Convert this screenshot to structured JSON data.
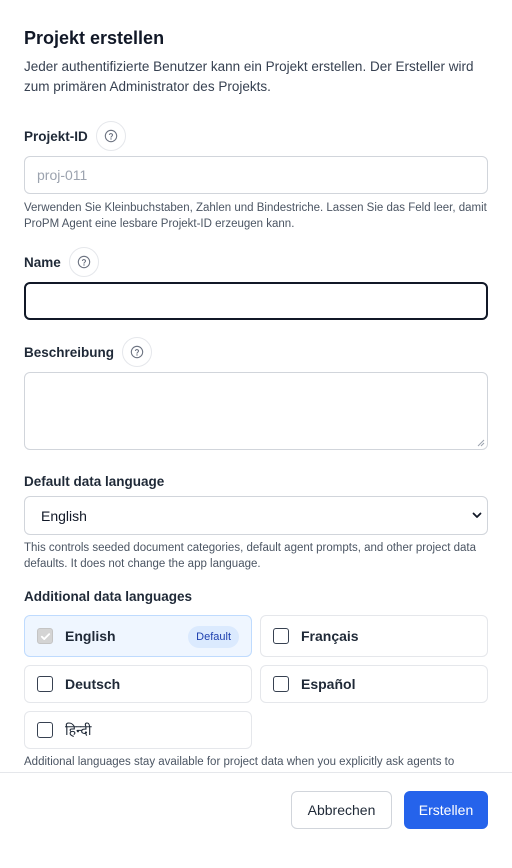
{
  "dialog": {
    "title": "Projekt erstellen",
    "subtitle": "Jeder authentifizierte Benutzer kann ein Projekt erstellen. Der Ersteller wird zum primären Administrator des Projekts."
  },
  "project_id": {
    "label": "Projekt-ID",
    "placeholder": "proj-011",
    "value": "",
    "hint": "Verwenden Sie Kleinbuchstaben, Zahlen und Bindestriche. Lassen Sie das Feld leer, damit ProPM Agent eine lesbare Projekt-ID erzeugen kann."
  },
  "name": {
    "label": "Name",
    "value": ""
  },
  "description": {
    "label": "Beschreibung",
    "value": ""
  },
  "default_language": {
    "label": "Default data language",
    "selected": "English",
    "hint": "This controls seeded document categories, default agent prompts, and other project data defaults. It does not change the app language."
  },
  "additional_languages": {
    "label": "Additional data languages",
    "items": [
      {
        "label": "English",
        "checked": true,
        "badge": "Default"
      },
      {
        "label": "Français",
        "checked": false
      },
      {
        "label": "Deutsch",
        "checked": false
      },
      {
        "label": "Español",
        "checked": false
      },
      {
        "label": "हिन्दी",
        "checked": false
      }
    ],
    "hint": "Additional languages stay available for project data when you explicitly ask agents to"
  },
  "footer": {
    "cancel_label": "Abbrechen",
    "submit_label": "Erstellen"
  },
  "colors": {
    "primary": "#2563eb",
    "selected_bg": "#eff6ff",
    "badge_bg": "#dbeafe"
  },
  "icons": {
    "help": "help-circle-icon",
    "select": "chevron-down-icon",
    "check": "check-icon"
  }
}
